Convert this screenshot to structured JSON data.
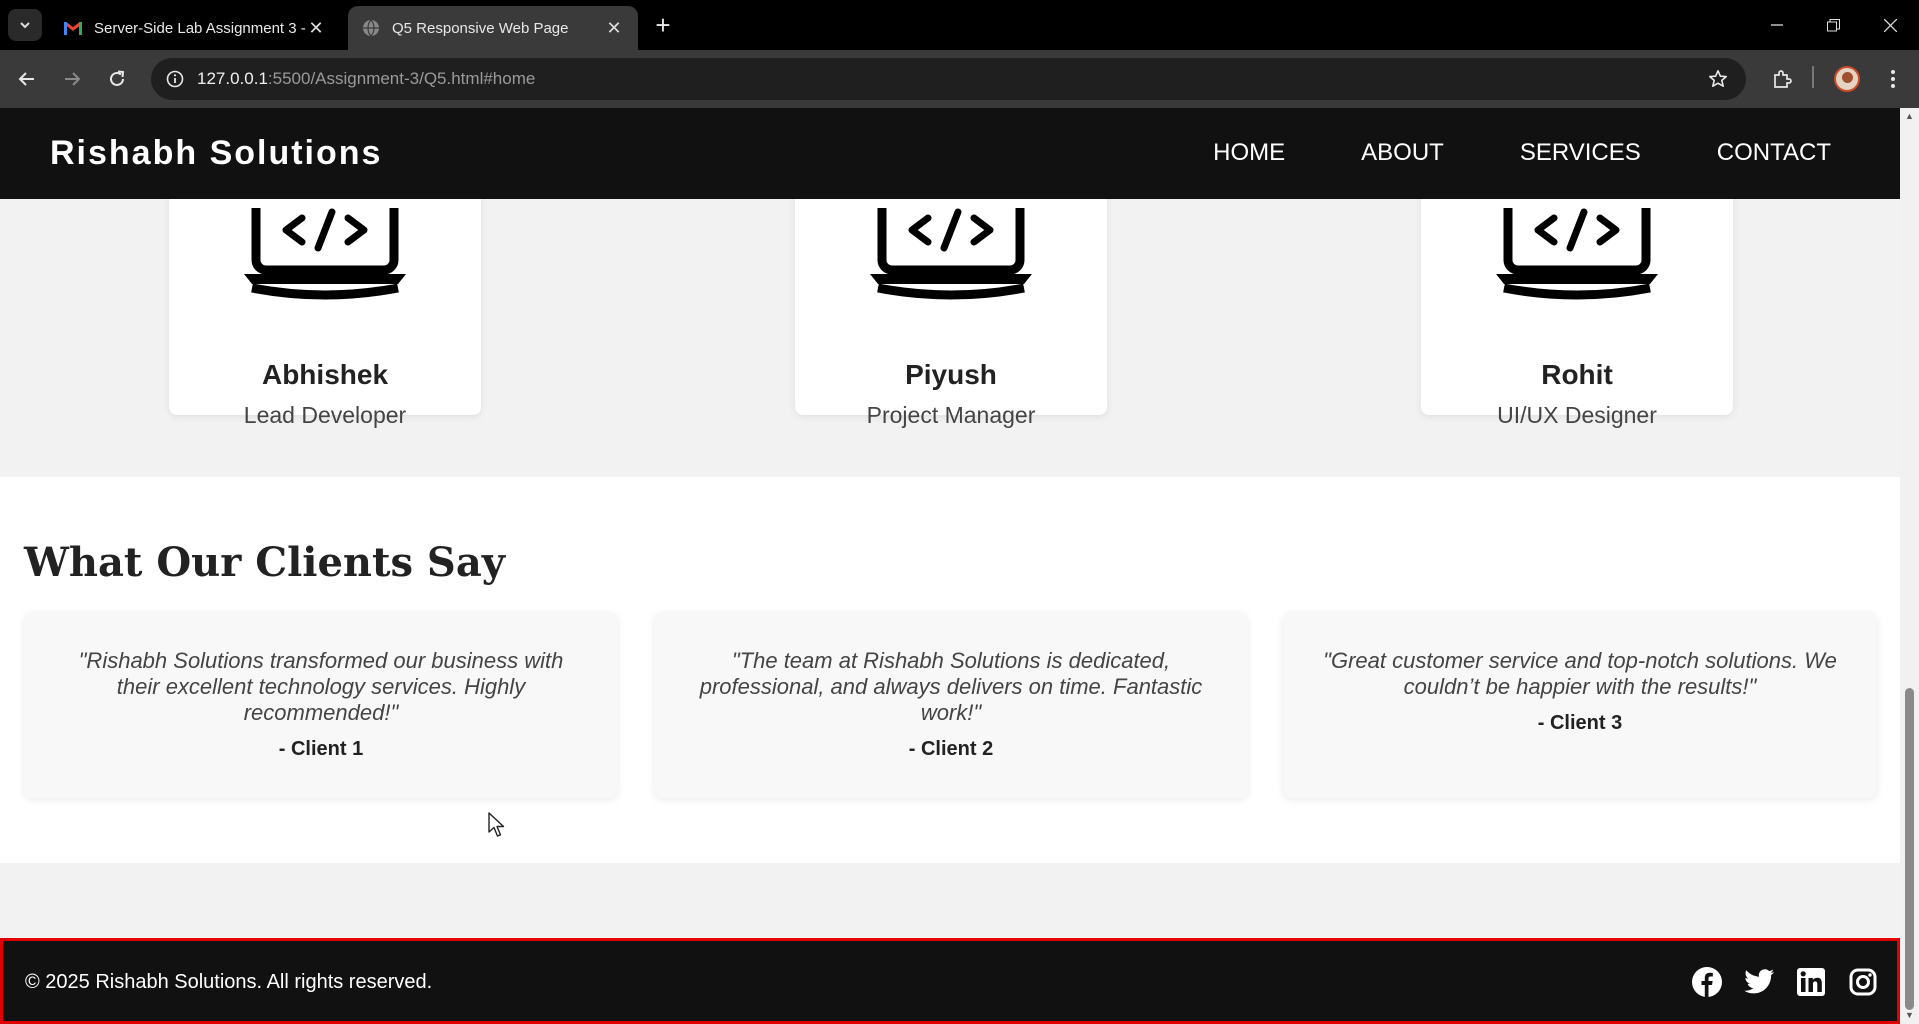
{
  "browser": {
    "tabs": [
      {
        "title": "Server-Side Lab Assignment 3 -",
        "icon": "gmail-icon",
        "active": false
      },
      {
        "title": "Q5 Responsive Web Page",
        "icon": "globe-icon",
        "active": true
      }
    ],
    "url_host": "127.0.0.1",
    "url_rest": ":5500/Assignment-3/Q5.html#home"
  },
  "site": {
    "brand": "Rishabh Solutions",
    "nav": [
      "HOME",
      "ABOUT",
      "SERVICES",
      "CONTACT"
    ]
  },
  "team": [
    {
      "name": "Abhishek",
      "role": "Lead Developer",
      "icon": "laptop-code-icon"
    },
    {
      "name": "Piyush",
      "role": "Project Manager",
      "icon": "laptop-code-icon"
    },
    {
      "name": "Rohit",
      "role": "UI/UX Designer",
      "icon": "laptop-code-icon"
    }
  ],
  "clients": {
    "title": "What Our Clients Say",
    "testimonials": [
      {
        "quote": "\"Rishabh Solutions transformed our business with their excellent technology services. Highly recommended!\"",
        "author": "- Client 1"
      },
      {
        "quote": "\"The team at Rishabh Solutions is dedicated, professional, and always delivers on time. Fantastic work!\"",
        "author": "- Client 2"
      },
      {
        "quote": "\"Great customer service and top-notch solutions. We couldn’t be happier with the results!\"",
        "author": "- Client 3"
      }
    ]
  },
  "footer": {
    "copyright": "© 2025 Rishabh Solutions. All rights reserved.",
    "socials": [
      "facebook-icon",
      "twitter-icon",
      "linkedin-icon",
      "instagram-icon"
    ],
    "highlight_color": "#e00000"
  }
}
